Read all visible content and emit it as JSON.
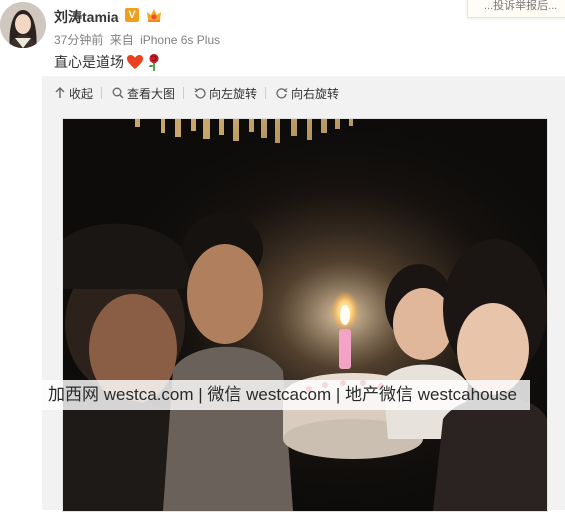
{
  "popup": {
    "text": "...投诉举报后..."
  },
  "author": {
    "name": "刘涛tamia",
    "verified_badge": "V",
    "avatar_icon": "avatar-icon",
    "member_badge_icon": "crown-badge-icon"
  },
  "meta": {
    "time": "37分钟前",
    "source_prefix": "来自",
    "source": "iPhone 6s Plus"
  },
  "post": {
    "text": "直心是道场",
    "emoji_1": "heart-icon",
    "emoji_2": "rose-icon"
  },
  "toolbar": {
    "collapse": "收起",
    "view_large": "查看大图",
    "rotate_left": "向左旋转",
    "rotate_right": "向右旋转"
  },
  "watermark": {
    "text": "加西网 westca.com | 微信 westcacom | 地产微信 westcahouse"
  },
  "colors": {
    "accent": "#eb7350",
    "username": "#333333",
    "meta": "#808080",
    "badge": "#f29d1b",
    "media_bg": "#f2f2f2"
  }
}
